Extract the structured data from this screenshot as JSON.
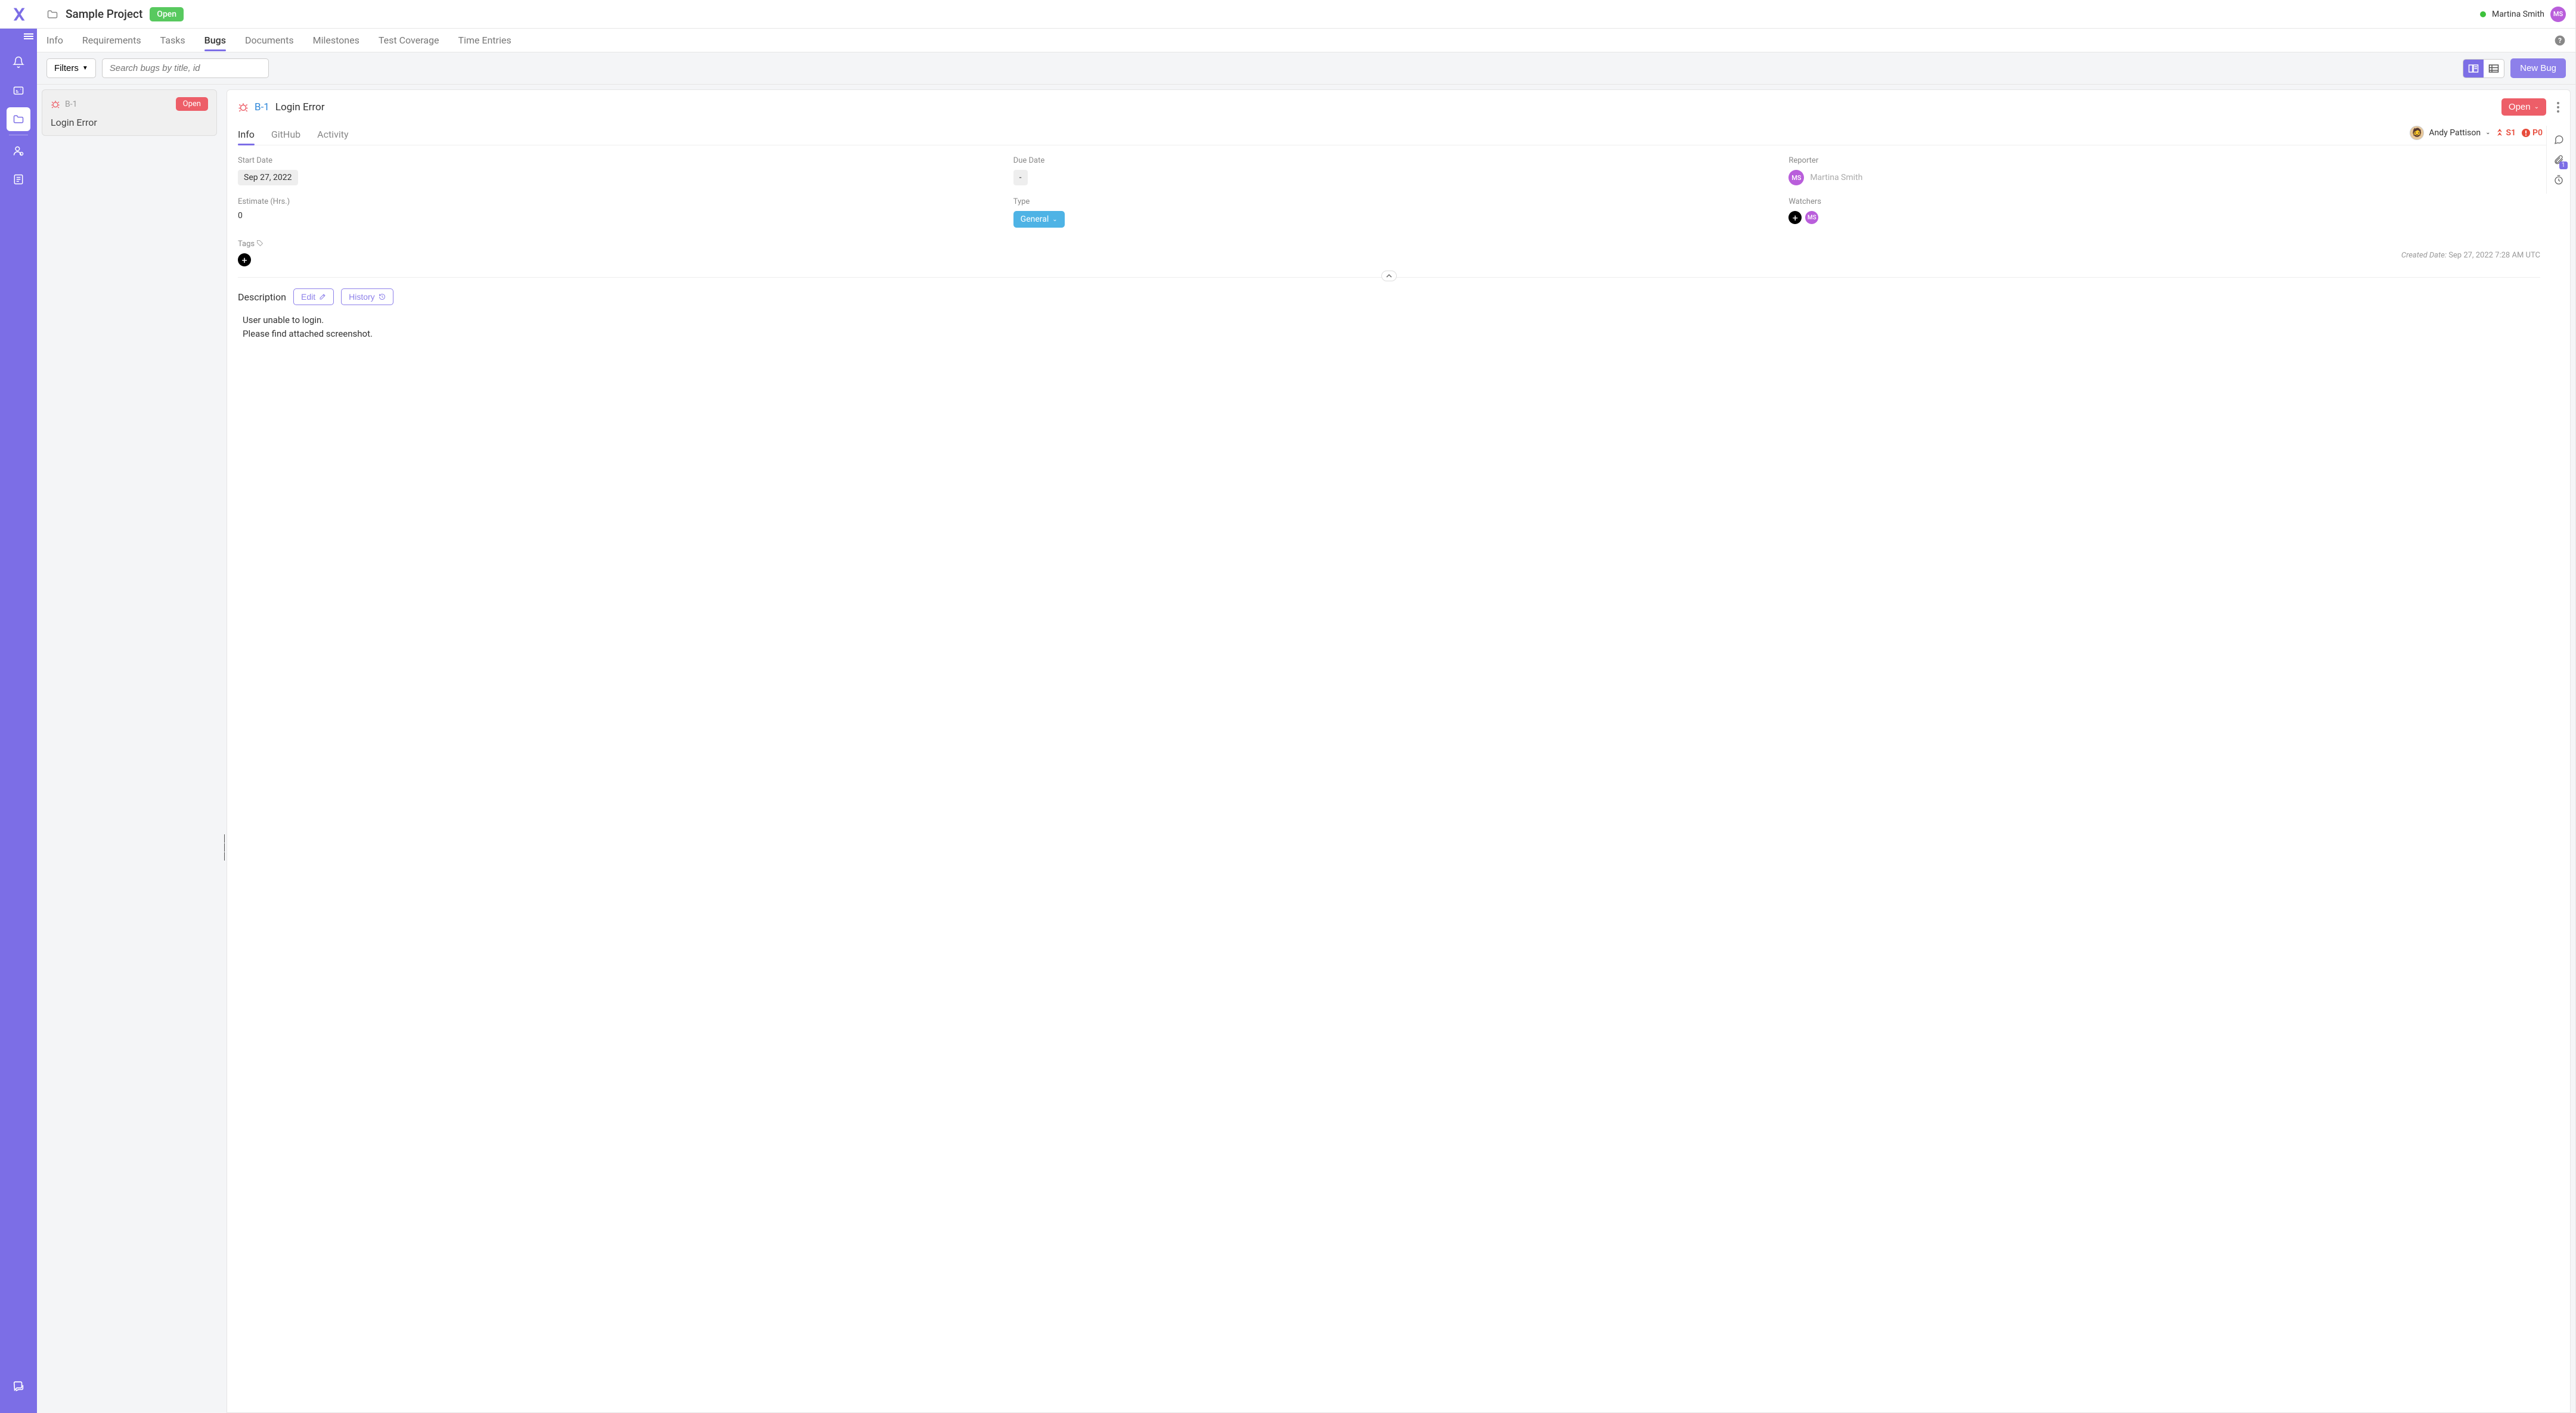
{
  "project": {
    "name": "Sample Project",
    "status": "Open"
  },
  "user": {
    "name": "Martina Smith",
    "initials": "MS"
  },
  "nav": {
    "tabs": [
      "Info",
      "Requirements",
      "Tasks",
      "Bugs",
      "Documents",
      "Milestones",
      "Test Coverage",
      "Time Entries"
    ],
    "active": "Bugs"
  },
  "filters": {
    "label": "Filters",
    "search_placeholder": "Search bugs by title, id",
    "new_bug": "New Bug"
  },
  "list": {
    "items": [
      {
        "id": "B-1",
        "title": "Login Error",
        "status": "Open"
      }
    ]
  },
  "detail": {
    "id": "B-1",
    "title": "Login Error",
    "status": "Open",
    "subtabs": [
      "Info",
      "GitHub",
      "Activity"
    ],
    "active_subtab": "Info",
    "assignee": "Andy Pattison",
    "severity": "S1",
    "priority": "P0",
    "fields": {
      "start_date_label": "Start Date",
      "start_date": "Sep 27, 2022",
      "due_date_label": "Due Date",
      "due_date": "-",
      "reporter_label": "Reporter",
      "reporter": "Martina Smith",
      "reporter_initials": "MS",
      "estimate_label": "Estimate (Hrs.)",
      "estimate": "0",
      "type_label": "Type",
      "type": "General",
      "watchers_label": "Watchers",
      "watchers_initials": "MS",
      "tags_label": "Tags"
    },
    "created_label": "Created Date:",
    "created": "Sep 27, 2022 7:28 AM UTC",
    "description_label": "Description",
    "edit_label": "Edit",
    "history_label": "History",
    "description": "User unable to login.\nPlease find attached screenshot.",
    "attachment_count": "1"
  }
}
